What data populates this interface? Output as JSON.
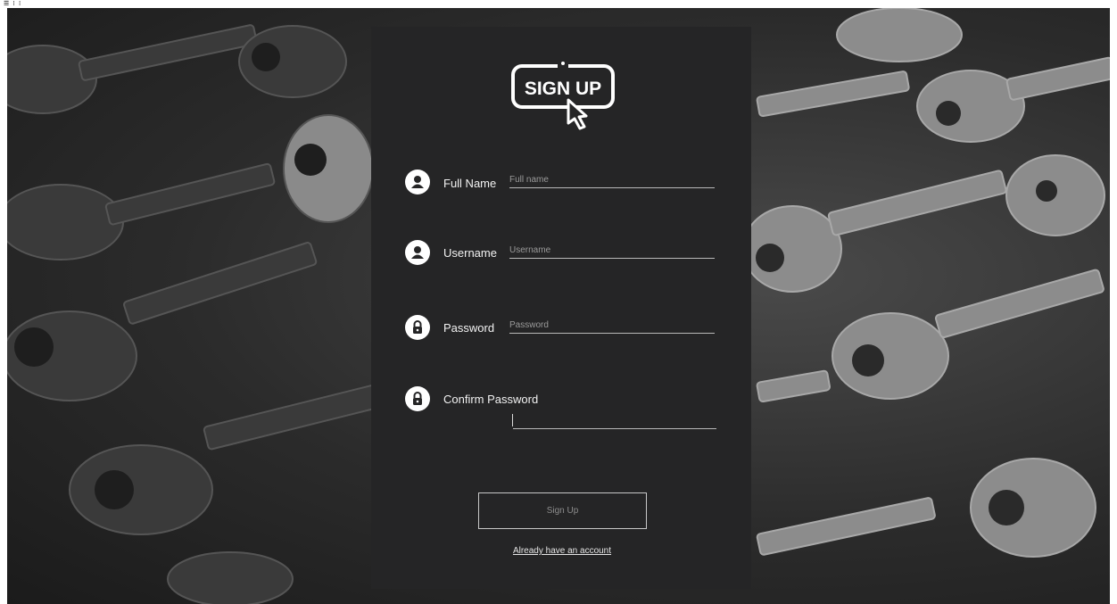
{
  "window": {
    "icon": "window-control-icons"
  },
  "logo": {
    "text": "SIGN UP"
  },
  "form": {
    "fields": [
      {
        "label": "Full Name",
        "placeholder": "Full name",
        "icon": "user-icon",
        "value": ""
      },
      {
        "label": "Username",
        "placeholder": "Username",
        "icon": "user-icon",
        "value": ""
      },
      {
        "label": "Password",
        "placeholder": "Password",
        "icon": "lock-icon",
        "value": ""
      },
      {
        "label": "Confirm Password",
        "placeholder": "",
        "icon": "lock-icon",
        "value": ""
      }
    ],
    "submit_label": "Sign Up",
    "login_link": "Already have an account"
  },
  "colors": {
    "panel": "#252526",
    "text": "#f2f2f2",
    "underline": "#b9b9b9",
    "background": "#2b2b2b"
  }
}
